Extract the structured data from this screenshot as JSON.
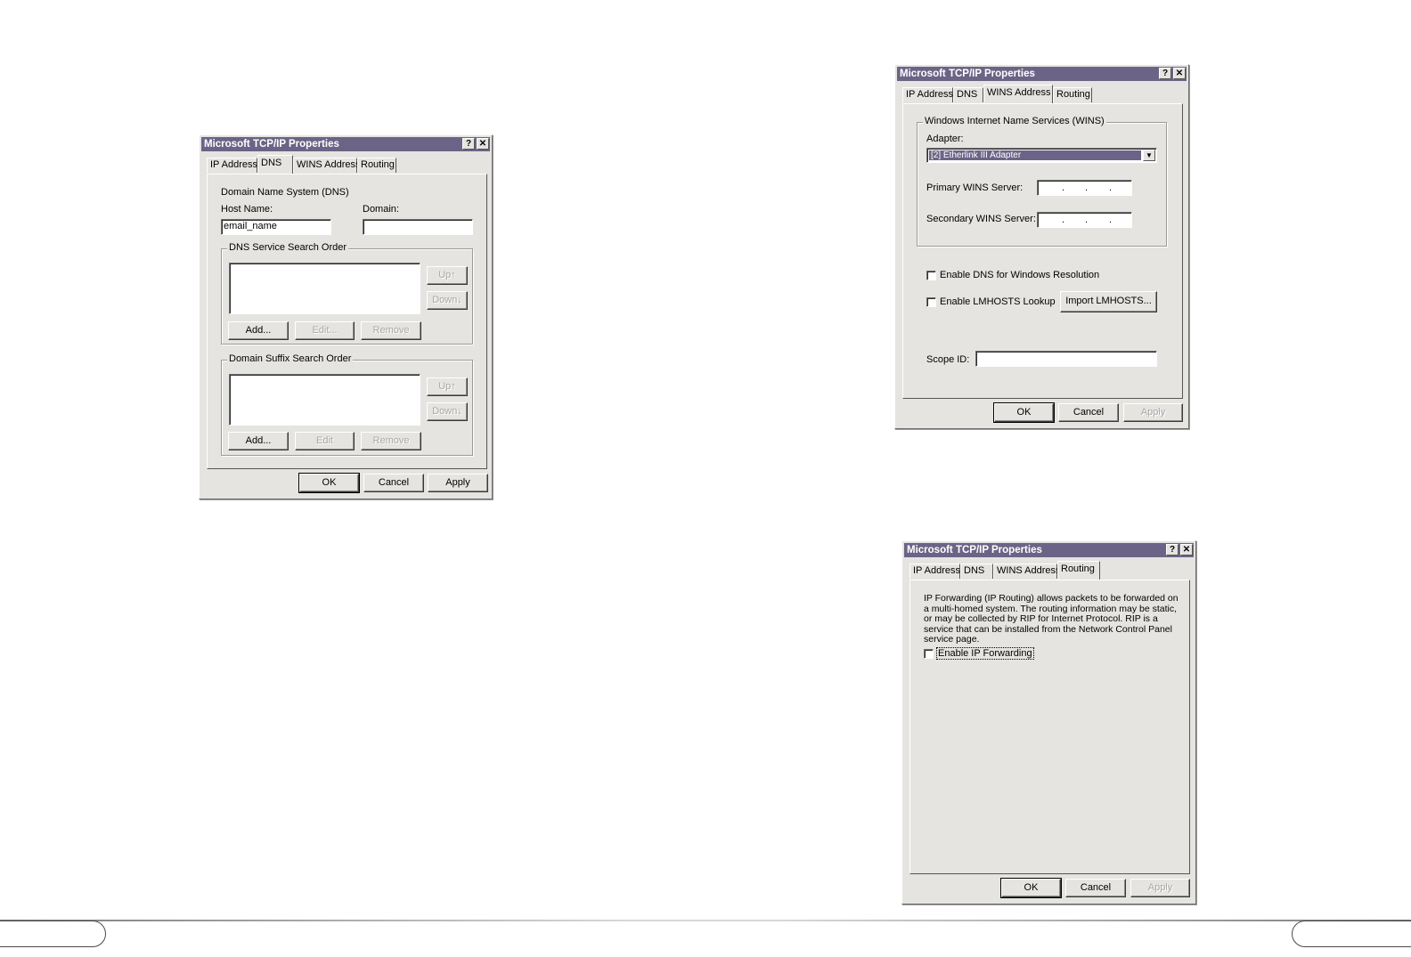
{
  "dialogs": {
    "dns": {
      "title": "Microsoft TCP/IP Properties",
      "help_button": "?",
      "close_button": "✕",
      "tabs": [
        "IP Address",
        "DNS",
        "WINS Address",
        "Routing"
      ],
      "section_title": "Domain Name System (DNS)",
      "host_name_label": "Host Name:",
      "host_name_value": "email_name",
      "domain_label": "Domain:",
      "domain_value": "",
      "dns_service_group": "DNS Service Search Order",
      "domain_suffix_group": "Domain Suffix Search Order",
      "up_button": "Up↑",
      "down_button": "Down↓",
      "add_button": "Add...",
      "edit_button": "Edit...",
      "edit_button_2": "Edit",
      "remove_button": "Remove",
      "ok_button": "OK",
      "cancel_button": "Cancel",
      "apply_button": "Apply"
    },
    "wins": {
      "title": "Microsoft TCP/IP Properties",
      "help_button": "?",
      "close_button": "✕",
      "tabs": [
        "IP Address",
        "DNS",
        "WINS Address",
        "Routing"
      ],
      "group_label": "Windows Internet Name Services (WINS)",
      "adapter_label": "Adapter:",
      "adapter_value": "[2]        Etherlink III Adapter",
      "primary_label": "Primary WINS Server:",
      "secondary_label": "Secondary WINS Server:",
      "enable_dns_label": "Enable DNS for Windows Resolution",
      "enable_lmhosts_label": "Enable LMHOSTS Lookup",
      "import_button": "Import LMHOSTS...",
      "scope_label": "Scope ID:",
      "scope_value": "",
      "ok_button": "OK",
      "cancel_button": "Cancel",
      "apply_button": "Apply"
    },
    "routing": {
      "title": "Microsoft TCP/IP Properties",
      "help_button": "?",
      "close_button": "✕",
      "tabs": [
        "IP Address",
        "DNS",
        "WINS Address",
        "Routing"
      ],
      "description": "IP Forwarding (IP Routing) allows packets to be forwarded on a multi-homed system.  The routing information may be static, or may be collected by RIP for Internet Protocol. RIP is a service that can be installed from the Network Control Panel service page.",
      "enable_forwarding_label": "Enable IP Forwarding",
      "ok_button": "OK",
      "cancel_button": "Cancel",
      "apply_button": "Apply"
    }
  },
  "colors": {
    "titlebar": "#6c6486",
    "dialog_face": "#e6e4e0",
    "page_background": "#ffffff"
  }
}
